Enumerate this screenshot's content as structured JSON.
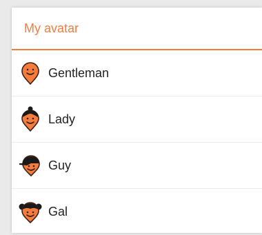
{
  "dialog": {
    "title": "My avatar",
    "accent_color": "#f47c3c",
    "items": [
      {
        "label": "Gentleman",
        "icon": "gentleman-avatar-icon"
      },
      {
        "label": "Lady",
        "icon": "lady-avatar-icon"
      },
      {
        "label": "Guy",
        "icon": "guy-avatar-icon"
      },
      {
        "label": "Gal",
        "icon": "gal-avatar-icon"
      }
    ]
  }
}
